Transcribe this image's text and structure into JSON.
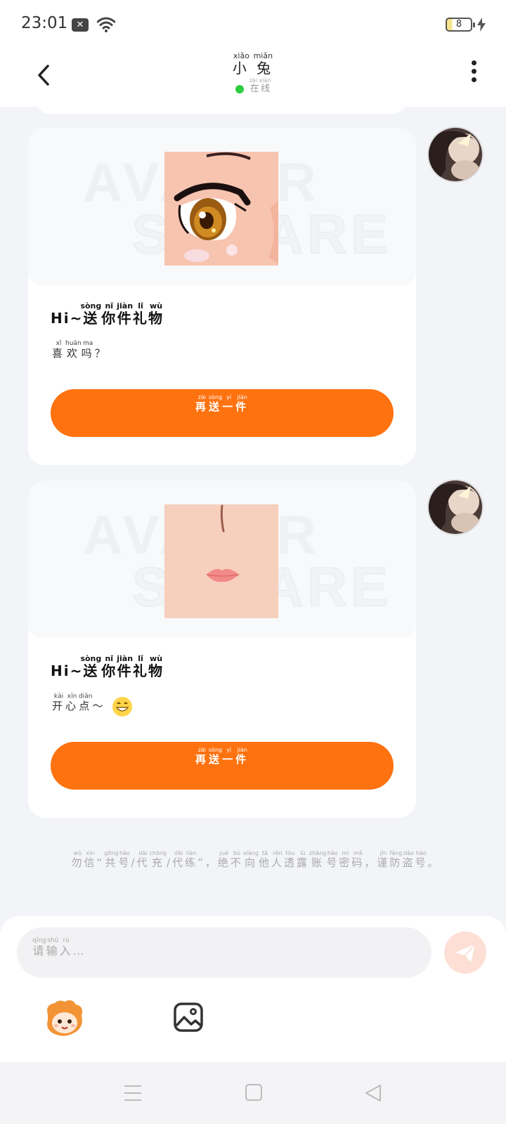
{
  "status": {
    "time": "23:01",
    "notification_icon": "x-box-icon",
    "wifi_icon": "wifi-icon",
    "battery_level": "8",
    "charging_icon": "bolt-icon"
  },
  "header": {
    "name": "小 兔",
    "name_pinyin": "xiǎo miǎn",
    "status_text": "在线",
    "status_pinyin": "zài xiàn",
    "status_color": "#2ecc40"
  },
  "messages": [
    {
      "gift_image": "eye-sticker",
      "title_prefix": "Hi~",
      "title_chars": [
        {
          "c": "送",
          "p": "sòng"
        },
        {
          "c": "你",
          "p": "nǐ"
        },
        {
          "c": "件",
          "p": "jiàn"
        },
        {
          "c": "礼",
          "p": "lǐ"
        },
        {
          "c": "物",
          "p": "wù"
        }
      ],
      "sub_chars": [
        {
          "c": "喜",
          "p": "xǐ"
        },
        {
          "c": "欢",
          "p": "huān"
        },
        {
          "c": "吗",
          "p": "ma"
        },
        {
          "c": "？",
          "p": ""
        }
      ],
      "button_chars": [
        {
          "c": "再",
          "p": "zài"
        },
        {
          "c": "送",
          "p": "sòng"
        },
        {
          "c": "一",
          "p": "yí"
        },
        {
          "c": "件",
          "p": "jiàn"
        }
      ]
    },
    {
      "gift_image": "nose-mouth-sticker",
      "title_prefix": "Hi~",
      "title_chars": [
        {
          "c": "送",
          "p": "sòng"
        },
        {
          "c": "你",
          "p": "nǐ"
        },
        {
          "c": "件",
          "p": "jiàn"
        },
        {
          "c": "礼",
          "p": "lǐ"
        },
        {
          "c": "物",
          "p": "wù"
        }
      ],
      "sub_chars": [
        {
          "c": "开",
          "p": "kāi"
        },
        {
          "c": "心",
          "p": "xīn"
        },
        {
          "c": "点",
          "p": "diǎn"
        },
        {
          "c": "～",
          "p": ""
        }
      ],
      "sub_emoji": "grin-emoji",
      "button_chars": [
        {
          "c": "再",
          "p": "zài"
        },
        {
          "c": "送",
          "p": "sòng"
        },
        {
          "c": "一",
          "p": "yí"
        },
        {
          "c": "件",
          "p": "jiàn"
        }
      ]
    }
  ],
  "watermark": [
    "AVATAR",
    "SQUARE"
  ],
  "notice_chars": [
    {
      "c": "勿",
      "p": "wù"
    },
    {
      "c": "信",
      "p": "xìn"
    },
    {
      "c": "“",
      "p": ""
    },
    {
      "c": "共",
      "p": "gōng"
    },
    {
      "c": "号",
      "p": "hào"
    },
    {
      "c": "/",
      "p": ""
    },
    {
      "c": "代",
      "p": "dài"
    },
    {
      "c": "充",
      "p": "chōng"
    },
    {
      "c": "/",
      "p": ""
    },
    {
      "c": "代",
      "p": "dài"
    },
    {
      "c": "练",
      "p": "liàn"
    },
    {
      "c": "”",
      "p": ""
    },
    {
      "c": "，",
      "p": ""
    },
    {
      "c": "绝",
      "p": "jué"
    },
    {
      "c": "不",
      "p": "bù"
    },
    {
      "c": "向",
      "p": "xiàng"
    },
    {
      "c": "他",
      "p": "tā"
    },
    {
      "c": "人",
      "p": "rén"
    },
    {
      "c": "透",
      "p": "tòu"
    },
    {
      "c": "露",
      "p": "lù"
    },
    {
      "c": "账",
      "p": "zhàng"
    },
    {
      "c": "号",
      "p": "hào"
    },
    {
      "c": "密",
      "p": "mì"
    },
    {
      "c": "码",
      "p": "mǎ"
    },
    {
      "c": "，",
      "p": ""
    },
    {
      "c": "谨",
      "p": "jǐn"
    },
    {
      "c": "防",
      "p": "fáng"
    },
    {
      "c": "盗",
      "p": "dào"
    },
    {
      "c": "号",
      "p": "hào"
    },
    {
      "c": "。",
      "p": ""
    }
  ],
  "composer": {
    "placeholder_chars": [
      {
        "c": "请",
        "p": "qǐng"
      },
      {
        "c": "输",
        "p": "shū"
      },
      {
        "c": "入",
        "p": "rù"
      },
      {
        "c": "…",
        "p": ""
      }
    ],
    "send_icon": "paper-plane-icon",
    "sticker_icon": "mascot-sticker-icon",
    "image_icon": "image-icon",
    "accent": "#fe7210"
  },
  "navbar": {
    "menu_icon": "menu-icon",
    "home_icon": "home-square-icon",
    "back_icon": "back-triangle-icon"
  }
}
